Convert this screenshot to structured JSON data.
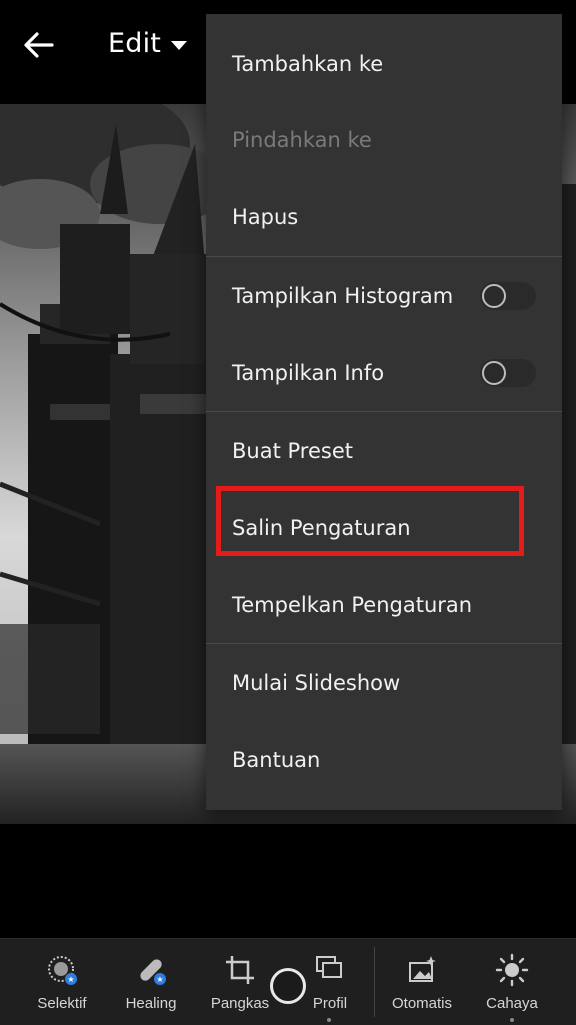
{
  "header": {
    "mode_label": "Edit"
  },
  "menu": {
    "items": [
      {
        "label": "Tambahkan ke"
      },
      {
        "label": "Pindahkan ke"
      },
      {
        "label": "Hapus"
      },
      {
        "label": "Tampilkan Histogram"
      },
      {
        "label": "Tampilkan Info"
      },
      {
        "label": "Buat Preset"
      },
      {
        "label": "Salin Pengaturan"
      },
      {
        "label": "Tempelkan Pengaturan"
      },
      {
        "label": "Mulai Slideshow"
      },
      {
        "label": "Bantuan"
      }
    ],
    "toggles": {
      "histogram_on": false,
      "info_on": false
    },
    "disabled_item": "Pindahkan ke",
    "highlight_color": "#e31b1b"
  },
  "toolbar": {
    "tools": [
      {
        "label": "Selektif",
        "icon": "selective-icon"
      },
      {
        "label": "Healing",
        "icon": "healing-icon"
      },
      {
        "label": "Pangkas",
        "icon": "crop-icon"
      },
      {
        "label": "Profil",
        "icon": "profile-icon"
      },
      {
        "label": "Otomatis",
        "icon": "auto-icon"
      },
      {
        "label": "Cahaya",
        "icon": "light-icon"
      }
    ]
  }
}
